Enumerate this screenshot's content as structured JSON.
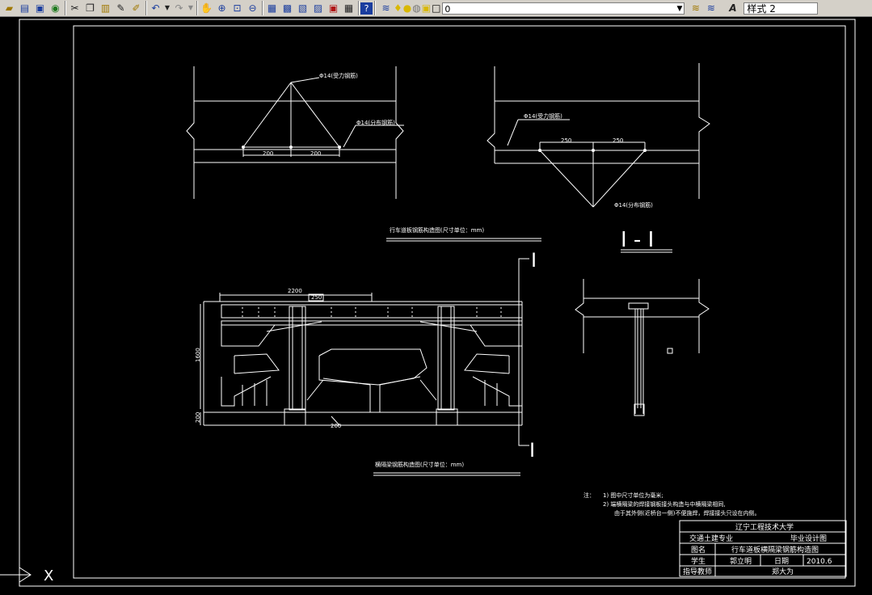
{
  "toolbar": {
    "layer_name": "0",
    "text_style": "样式 2",
    "icons": [
      "folder-icon",
      "print-icon",
      "preview-icon",
      "publish-icon",
      "cut-icon",
      "copy-icon",
      "paste-icon",
      "match-properties-icon",
      "brush-icon",
      "undo-icon",
      "redo-icon",
      "pan-icon",
      "zoom-realtime-icon",
      "zoom-window-icon",
      "zoom-previous-icon",
      "properties-icon",
      "design-center-icon",
      "tool-palette-icon",
      "sheet-set-icon",
      "markup-icon",
      "calculator-icon",
      "help-icon"
    ]
  },
  "drawing": {
    "top_left_labels": {
      "force_rebar": "Φ14(受力钢筋)",
      "dist_rebar": "Φ14(分布钢筋)",
      "dim_a": "200",
      "dim_b": "200"
    },
    "top_right_labels": {
      "force_rebar": "Φ14(受力钢筋)",
      "dist_rebar": "Φ14(分布钢筋)",
      "dim_a": "250",
      "dim_b": "250"
    },
    "deck_title": "行车道板钢筋构造图(尺寸单位：mm)",
    "section_label": "I - I",
    "cut_mark_top": "I",
    "cut_mark_bottom": "I",
    "beam_dims": {
      "width": "2200",
      "inner": "250",
      "height": "1600",
      "base": "200",
      "bottom": "200"
    },
    "beam_title": "横隔梁钢筋构造图(尺寸单位：mm)",
    "notes": {
      "prefix": "注：",
      "line1": "1) 图中尺寸单位为毫米;",
      "line2": "2) 端横隔梁的焊接钢板接头构造与中横隔梁相同,",
      "line3": "由于其外侧(近桥台一侧)不便施焊，焊接接头只设在内侧。"
    },
    "title_block": {
      "school": "辽宁工程技术大学",
      "major": "交通土建专业",
      "design_type": "毕业设计图",
      "drawing_label": "图名",
      "drawing_name": "行车道板横隔梁钢筋构造图",
      "student_label": "学生",
      "student_name": "郭立明",
      "date_label": "日期",
      "date_value": "2010.6",
      "advisor_label": "指导教师",
      "advisor_name": "郑大为"
    },
    "ucs_x": "X"
  }
}
